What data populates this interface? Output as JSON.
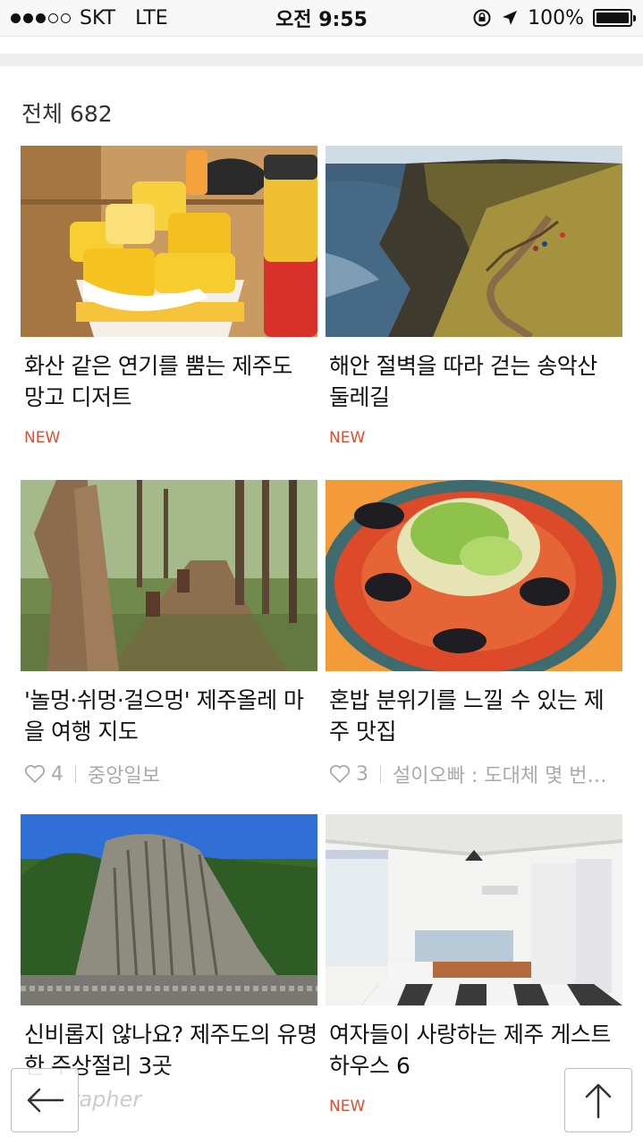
{
  "status_bar": {
    "carrier": "SKT",
    "network": "LTE",
    "time": "오전 9:55",
    "battery": "100%"
  },
  "header": {
    "total_label": "전체 682"
  },
  "cards": [
    {
      "title": "화산 같은 연기를 뿜는 제주도 망고 디저트",
      "badge": "NEW"
    },
    {
      "title": "해안 절벽을 따라 걷는 송악산 둘레길",
      "badge": "NEW"
    },
    {
      "title": "'놀멍·쉬멍·걸으멍' 제주올레 마을 여행 지도",
      "likes": "4",
      "source": "중앙일보"
    },
    {
      "title": "혼밥 분위기를 느낄 수 있는 제주 맛집",
      "likes": "3",
      "source": "설이오빠 : 도대체 몇 번…"
    },
    {
      "title": "신비롭지 않나요? 제주도의 유명한 주상절리 3곳"
    },
    {
      "title": "여자들이 사랑하는 제주 게스트하우스 6",
      "badge": "NEW"
    }
  ],
  "footer": {
    "brand_text": "Grapher"
  },
  "colors": {
    "accent_new": "#e8492c"
  },
  "icons": [
    "back-arrow-icon",
    "scroll-top-icon",
    "heart-icon",
    "location-icon",
    "lock-rotation-icon"
  ]
}
